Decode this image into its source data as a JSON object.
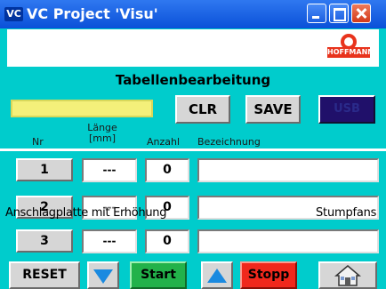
{
  "window": {
    "title": "VC Project 'Visu'",
    "icon_text": "VC",
    "controls": {
      "minimize_icon": "minimize-icon",
      "maximize_icon": "maximize-icon",
      "close_icon": "close-icon"
    },
    "title_bar_color": "#0a50d8",
    "background_color": "#00cccc"
  },
  "header": {
    "logo_text": "HOFFMANN",
    "heading": "Tabellenbearbeitung"
  },
  "toolbar": {
    "input_value": "",
    "input_color": "#f4f07a",
    "clr_label": "CLR",
    "save_label": "SAVE",
    "usb_label": "USB"
  },
  "table": {
    "columns": {
      "nr": "Nr",
      "laenge_line1": "Länge",
      "laenge_line2": "[mm]",
      "anzahl": "Anzahl",
      "bezeichnung": "Bezeichnung"
    },
    "rows": [
      {
        "nr": "1",
        "laenge": "---",
        "anzahl": "0",
        "bezeichnung": ""
      },
      {
        "nr": "2",
        "laenge": "---",
        "anzahl": "0",
        "bezeichnung": "Anschlagplatte mit Erhöhung",
        "bezeichnung_right": "Stumpfans"
      },
      {
        "nr": "3",
        "laenge": "---",
        "anzahl": "0",
        "bezeichnung": ""
      }
    ]
  },
  "footer": {
    "reset_label": "RESET",
    "down_icon": "arrow-down-icon",
    "start_label": "Start",
    "up_icon": "arrow-up-icon",
    "stopp_label": "Stopp",
    "home_icon": "home-icon",
    "start_color": "#22b24a",
    "stopp_color": "#f0281c"
  }
}
